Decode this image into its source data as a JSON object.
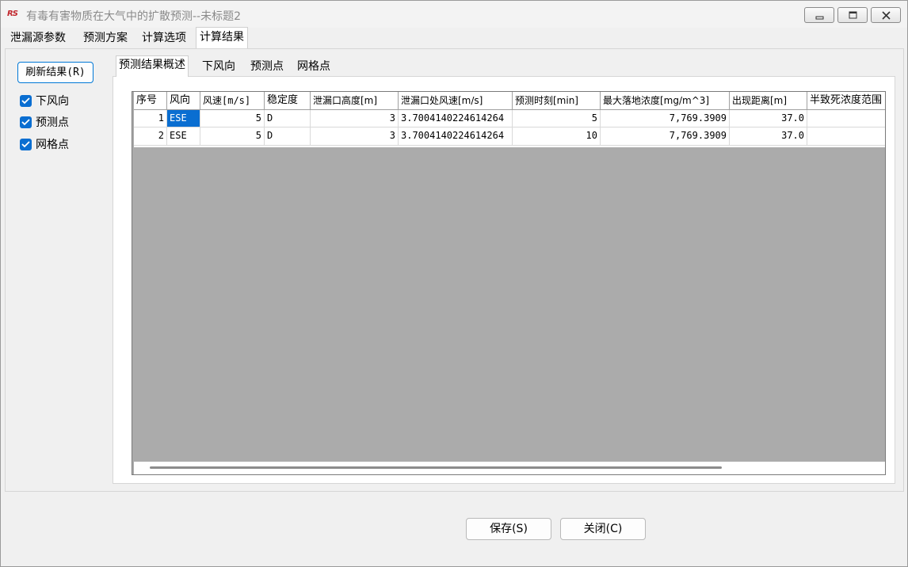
{
  "window": {
    "title": "有毒有害物质在大气中的扩散预测--未标题2",
    "app_icon_text": "RS"
  },
  "main_tabs": [
    {
      "label": "泄漏源参数",
      "active": false
    },
    {
      "label": "预测方案",
      "active": false
    },
    {
      "label": "计算选项",
      "active": false
    },
    {
      "label": "计算结果",
      "active": true
    }
  ],
  "left_panel": {
    "refresh_label": "刷新结果(R)",
    "checkboxes": [
      {
        "label": "下风向",
        "checked": true
      },
      {
        "label": "预测点",
        "checked": true
      },
      {
        "label": "网格点",
        "checked": true
      }
    ]
  },
  "result_tabs": [
    {
      "label": "预测结果概述",
      "active": true
    },
    {
      "label": "下风向",
      "active": false
    },
    {
      "label": "预测点",
      "active": false
    },
    {
      "label": "网格点",
      "active": false
    }
  ],
  "table": {
    "columns": [
      "序号",
      "风向",
      "风速[m/s]",
      "稳定度",
      "泄漏口高度[m]",
      "泄漏口处风速[m/s]",
      "预测时刻[min]",
      "最大落地浓度[mg/m^3]",
      "出现距离[m]",
      "半致死浓度范围"
    ],
    "rows": [
      [
        "1",
        "ESE",
        "5",
        "D",
        "3",
        "3.7004140224614264",
        "5",
        "7,769.3909",
        "37.0",
        ""
      ],
      [
        "2",
        "ESE",
        "5",
        "D",
        "3",
        "3.7004140224614264",
        "10",
        "7,769.3909",
        "37.0",
        ""
      ]
    ]
  },
  "footer": {
    "save_label": "保存(S)",
    "close_label": "关闭(C)"
  },
  "colors": {
    "accent": "#0a6ed1",
    "grid_empty": "#ababab"
  }
}
